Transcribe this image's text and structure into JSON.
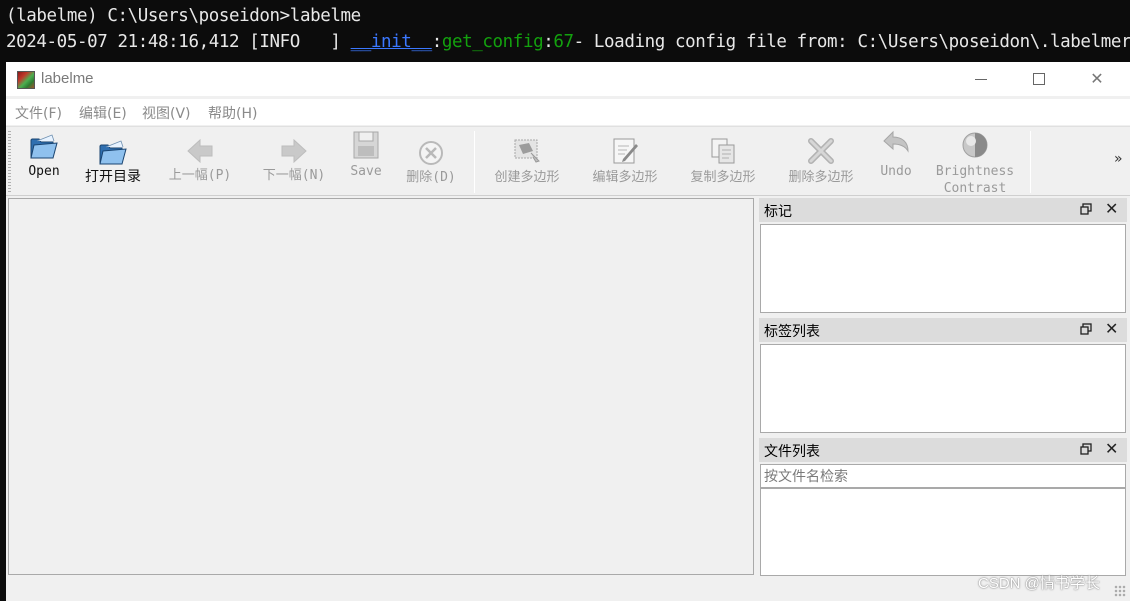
{
  "console": {
    "line1": "(labelme) C:\\Users\\poseidon>labelme",
    "line2_prefix": "2024-05-07 21:48:16,412 [INFO   ] ",
    "line2_module": "__init__",
    "line2_sep1": ":",
    "line2_func": "get_config",
    "line2_sep2": ":",
    "line2_lineno": "67",
    "line2_message": "- Loading config file from: C:\\Users\\poseidon\\.labelmerc"
  },
  "window": {
    "title": "labelme",
    "minimize_glyph": "—",
    "maximize_glyph": "☐",
    "close_glyph": "✕"
  },
  "menu": {
    "items": [
      {
        "label": "文件(F)"
      },
      {
        "label": "编辑(E)"
      },
      {
        "label": "视图(V)"
      },
      {
        "label": "帮助(H)"
      }
    ]
  },
  "toolbar": {
    "open": "Open",
    "open_dir": "打开目录",
    "prev": "上一幅(P)",
    "next": "下一幅(N)",
    "save": "Save",
    "delete": "删除(D)",
    "create_polygon": "创建多边形",
    "edit_polygon": "编辑多边形",
    "copy_polygon": "复制多边形",
    "delete_polygon": "删除多边形",
    "undo": "Undo",
    "brightness": "Brightness\nContrast",
    "overflow": "»"
  },
  "docks": {
    "flags": {
      "title": "标记"
    },
    "labels": {
      "title": "标签列表"
    },
    "files": {
      "title": "文件列表",
      "search_placeholder": "按文件名检索"
    },
    "close_glyph": "✕"
  },
  "watermark": "CSDN @情书学长",
  "icons": {
    "open": "folder-open-icon",
    "open_dir": "folder-open-icon",
    "prev": "arrow-left-icon",
    "next": "arrow-right-icon",
    "save": "floppy-disk-icon",
    "delete": "cancel-circle-icon",
    "create_polygon": "polygon-create-icon",
    "edit_polygon": "polygon-edit-icon",
    "copy_polygon": "polygon-copy-icon",
    "delete_polygon": "polygon-delete-icon",
    "undo": "undo-icon",
    "brightness": "brightness-contrast-icon"
  }
}
